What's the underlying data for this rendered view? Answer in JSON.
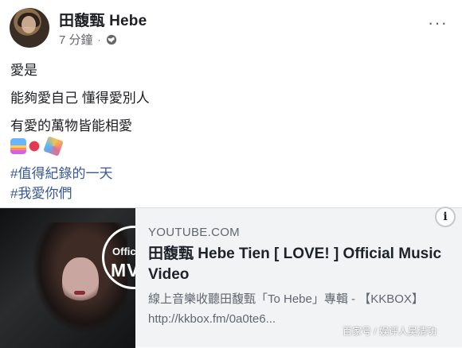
{
  "post": {
    "author": "田馥甄 Hebe",
    "time": "7 分鐘",
    "dot": "·",
    "more": "···",
    "lines": [
      "愛是",
      "能夠愛自己 懂得愛別人",
      "有愛的萬物皆能相愛"
    ],
    "emojis": [
      "rainbow",
      "hearts",
      "confetti"
    ],
    "hashtags": [
      "#值得紀錄的一天",
      "#我愛你們"
    ]
  },
  "link_card": {
    "domain": "YOUTUBE.COM",
    "title": "田馥甄 Hebe Tien [ LOVE! ] Official Music Video",
    "description": "線上音樂收聽田馥甄「To Hebe」專輯 - 【KKBOX】http://kkbox.fm/0a0te6...",
    "thumb_badge_top": "Offici",
    "thumb_badge_bottom": "MV",
    "info": "i"
  },
  "watermark": "百家号 / 娱评人吴清功"
}
